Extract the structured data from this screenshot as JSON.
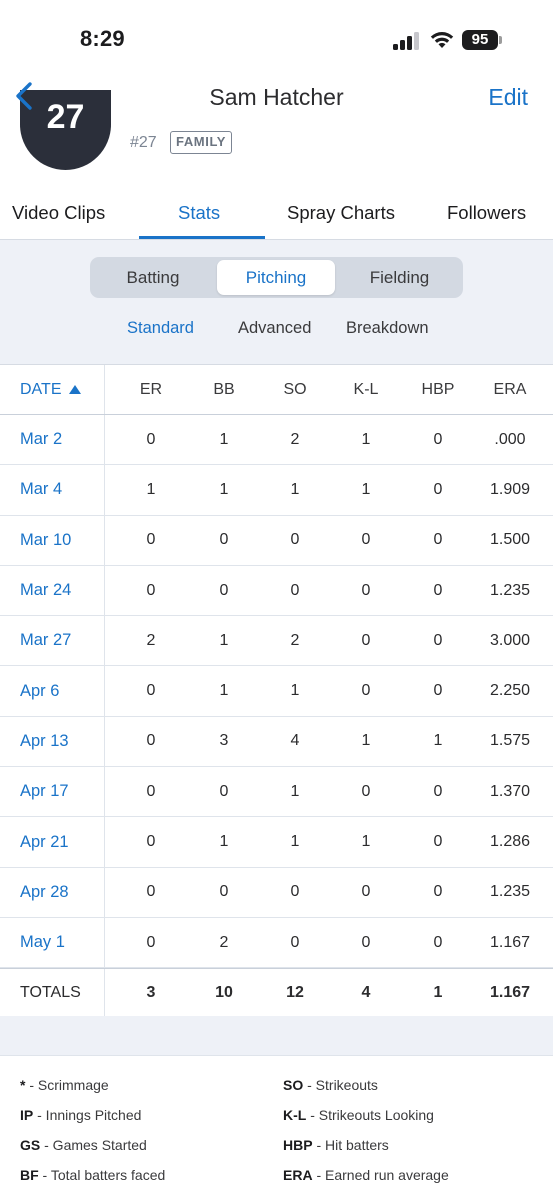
{
  "status_bar": {
    "time": "8:29",
    "battery": "95"
  },
  "nav": {
    "title": "Sam Hatcher",
    "edit_label": "Edit"
  },
  "profile": {
    "avatar_number": "27",
    "number_label": "#27",
    "badge": "FAMILY"
  },
  "main_tabs": [
    {
      "label": "Video Clips",
      "active": false
    },
    {
      "label": "Stats",
      "active": true
    },
    {
      "label": "Spray Charts",
      "active": false
    },
    {
      "label": "Followers",
      "active": false
    }
  ],
  "stat_category": {
    "options": [
      "Batting",
      "Pitching",
      "Fielding"
    ],
    "selected": "Pitching"
  },
  "stat_view": {
    "options": [
      "Standard",
      "Advanced",
      "Breakdown"
    ],
    "selected": "Standard"
  },
  "table": {
    "columns": [
      "DATE",
      "ER",
      "BB",
      "SO",
      "K-L",
      "HBP",
      "ERA"
    ],
    "sort_column": "DATE",
    "sort_direction": "ascending",
    "rows": [
      {
        "date": "Mar 2",
        "er": "0",
        "bb": "1",
        "so": "2",
        "kl": "1",
        "hbp": "0",
        "era": ".000"
      },
      {
        "date": "Mar 4",
        "er": "1",
        "bb": "1",
        "so": "1",
        "kl": "1",
        "hbp": "0",
        "era": "1.909"
      },
      {
        "date": "Mar 10",
        "er": "0",
        "bb": "0",
        "so": "0",
        "kl": "0",
        "hbp": "0",
        "era": "1.500"
      },
      {
        "date": "Mar 24",
        "er": "0",
        "bb": "0",
        "so": "0",
        "kl": "0",
        "hbp": "0",
        "era": "1.235"
      },
      {
        "date": "Mar 27",
        "er": "2",
        "bb": "1",
        "so": "2",
        "kl": "0",
        "hbp": "0",
        "era": "3.000"
      },
      {
        "date": "Apr 6",
        "er": "0",
        "bb": "1",
        "so": "1",
        "kl": "0",
        "hbp": "0",
        "era": "2.250"
      },
      {
        "date": "Apr 13",
        "er": "0",
        "bb": "3",
        "so": "4",
        "kl": "1",
        "hbp": "1",
        "era": "1.575"
      },
      {
        "date": "Apr 17",
        "er": "0",
        "bb": "0",
        "so": "1",
        "kl": "0",
        "hbp": "0",
        "era": "1.370"
      },
      {
        "date": "Apr 21",
        "er": "0",
        "bb": "1",
        "so": "1",
        "kl": "1",
        "hbp": "0",
        "era": "1.286"
      },
      {
        "date": "Apr 28",
        "er": "0",
        "bb": "0",
        "so": "0",
        "kl": "0",
        "hbp": "0",
        "era": "1.235"
      },
      {
        "date": "May 1",
        "er": "0",
        "bb": "2",
        "so": "0",
        "kl": "0",
        "hbp": "0",
        "era": "1.167"
      }
    ],
    "totals": {
      "label": "TOTALS",
      "er": "3",
      "bb": "10",
      "so": "12",
      "kl": "4",
      "hbp": "1",
      "era": "1.167"
    }
  },
  "legend": [
    {
      "abbr": "*",
      "desc": " - Scrimmage"
    },
    {
      "abbr": "SO",
      "desc": " - Strikeouts"
    },
    {
      "abbr": "IP",
      "desc": " - Innings Pitched"
    },
    {
      "abbr": "K-L",
      "desc": " - Strikeouts Looking"
    },
    {
      "abbr": "GS",
      "desc": " - Games Started"
    },
    {
      "abbr": "HBP",
      "desc": " - Hit batters"
    },
    {
      "abbr": "BF",
      "desc": " - Total batters faced"
    },
    {
      "abbr": "ERA",
      "desc": " - Earned run average"
    }
  ],
  "colors": {
    "accent": "#1a73c8",
    "panel_bg": "#eef1f7",
    "segment_bg": "#d3d9e2"
  }
}
